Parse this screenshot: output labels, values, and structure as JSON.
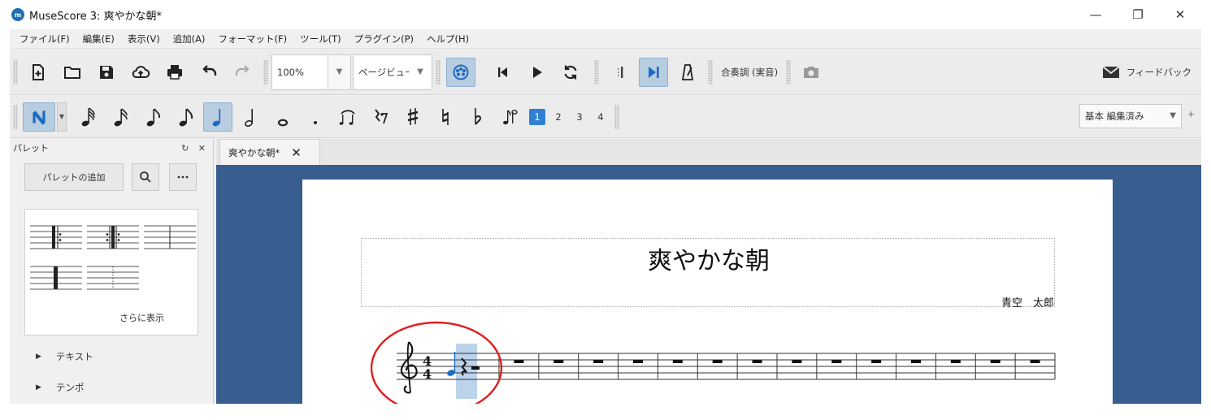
{
  "window": {
    "app_icon": "musescore-logo-icon",
    "title": "MuseScore 3: 爽やかな朝*",
    "controls": {
      "minimize": "—",
      "restore": "❐",
      "close": "✕"
    }
  },
  "menu": {
    "items": [
      "ファイル(F)",
      "編集(E)",
      "表示(V)",
      "追加(A)",
      "フォーマット(F)",
      "ツール(T)",
      "プラグイン(P)",
      "ヘルプ(H)"
    ]
  },
  "toolbar": {
    "file_buttons": [
      "new-file-icon",
      "open-folder-icon",
      "save-icon",
      "cloud-upload-icon",
      "print-icon",
      "undo-icon",
      "redo-icon"
    ],
    "zoom_value": "100%",
    "view_mode": "ページビュー",
    "playback_buttons": [
      "midi-input-icon",
      "rewind-icon",
      "play-icon",
      "loop-icon",
      "loop-in-icon",
      "playback-mode-icon",
      "metronome-icon"
    ],
    "concert_pitch": "合奏調 (実音)",
    "screenshot_icon": "camera-icon",
    "feedback": "フィードバック"
  },
  "note_input": {
    "durations": [
      "64th",
      "32nd",
      "16th",
      "eighth",
      "quarter",
      "half",
      "whole",
      "dot"
    ],
    "selected_duration": "quarter",
    "voices": [
      "1",
      "2",
      "3",
      "4"
    ],
    "selected_voice": "1",
    "workspace": "基本 編集済み",
    "workspace_plus": "+"
  },
  "palette": {
    "title": "パレット",
    "header_controls": "↻ ✕",
    "add_button": "パレットの追加",
    "more": "さらに表示",
    "sections": [
      "テキスト",
      "テンポ"
    ]
  },
  "score": {
    "tab_label": "爽やかな朝*",
    "title": "爽やかな朝",
    "composer": "青空　太郎",
    "time_signature": {
      "numerator": "4",
      "denominator": "4"
    },
    "measure_count": 15
  },
  "colors": {
    "selection": "#1d6bc2",
    "score_background": "#385d8f",
    "annotation_circle": "#e02020"
  }
}
